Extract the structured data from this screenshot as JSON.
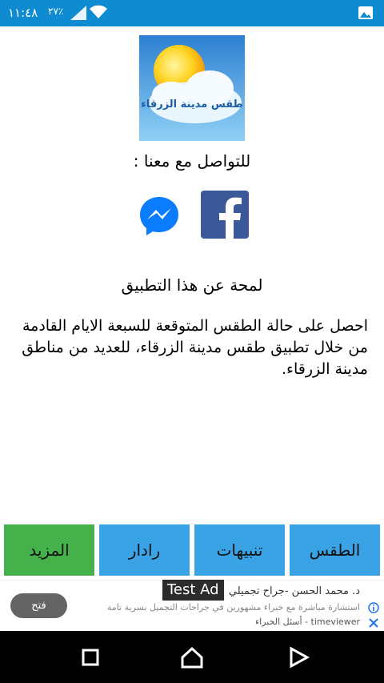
{
  "status_bar": {
    "time": "١١:٤٨",
    "battery_label": "٢٧٪",
    "icons": [
      "signal-icon",
      "wifi-icon",
      "image-notification-icon"
    ]
  },
  "app": {
    "icon_text": "طقس مدينة الزرقاء",
    "contact_title": "للتواصل مع معنا :",
    "about_title": "لمحة عن هذا التطبيق",
    "about_text": "احصل على حالة الطقس المتوقعة للسبعة الايام القادمة من خلال تطبيق طقس مدينة الزرقاء، للعديد من مناطق مدينة الزرقاء."
  },
  "tabs": [
    {
      "label": "الطقس"
    },
    {
      "label": "تنبيهات"
    },
    {
      "label": "رادار"
    },
    {
      "label": "المزيد"
    }
  ],
  "ad": {
    "badge": "Test Ad",
    "title": "د. محمد الحسن -جراح تجميلي",
    "line2": "استشارة مباشرة مع خبراء مشهورين في جراحات التجميل بسرية تامة",
    "line3": "timeviewer - أسئل الخبراء",
    "button": "فتح"
  },
  "colors": {
    "status_bar": "#0e8bd1",
    "tab_blue": "#3aa3e6",
    "tab_green": "#45b14a",
    "facebook": "#3b5998",
    "messenger": "#0a7cff"
  }
}
